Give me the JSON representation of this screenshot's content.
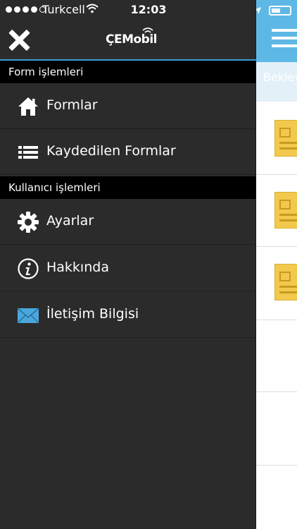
{
  "status_bar": {
    "carrier": "Turkcell",
    "time": "12:03"
  },
  "header": {
    "logo_text": "ÇEMobil"
  },
  "app": {
    "subbar_text": "Bekley"
  },
  "sections": [
    {
      "title": "Form işlemleri",
      "items": [
        {
          "label": "Formlar",
          "icon": "home-icon"
        },
        {
          "label": "Kaydedilen Formlar",
          "icon": "list-icon"
        }
      ]
    },
    {
      "title": "Kullanıcı işlemleri",
      "items": [
        {
          "label": "Ayarlar",
          "icon": "gear-icon"
        },
        {
          "label": "Hakkında",
          "icon": "info-icon"
        },
        {
          "label": "İletişim Bilgisi",
          "icon": "envelope-icon"
        }
      ]
    }
  ],
  "colors": {
    "drawer_bg": "#2b2b2b",
    "section_bg": "#000000",
    "accent": "#5eb8e5",
    "divider": "#3aa0d5"
  }
}
